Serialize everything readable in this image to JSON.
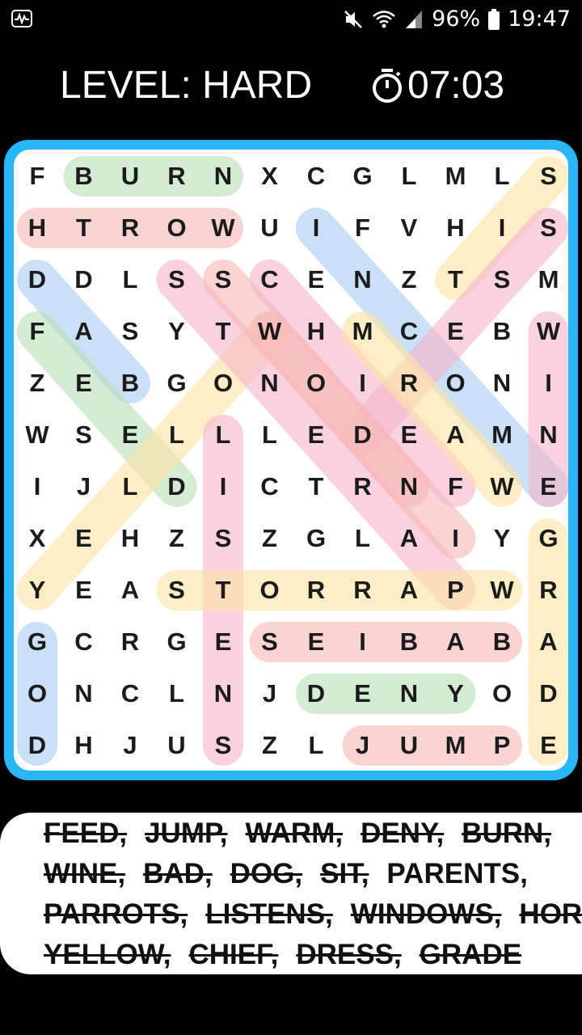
{
  "status": {
    "battery": "96%",
    "time": "19:47"
  },
  "header": {
    "level": "LEVEL: HARD",
    "timer": "07:03"
  },
  "grid": [
    [
      "F",
      "B",
      "U",
      "R",
      "N",
      "X",
      "C",
      "G",
      "L",
      "M",
      "L",
      "S"
    ],
    [
      "H",
      "T",
      "R",
      "O",
      "W",
      "U",
      "I",
      "F",
      "V",
      "H",
      "I",
      "S"
    ],
    [
      "D",
      "D",
      "L",
      "S",
      "S",
      "C",
      "E",
      "N",
      "Z",
      "T",
      "S",
      "M"
    ],
    [
      "F",
      "A",
      "S",
      "Y",
      "T",
      "W",
      "H",
      "M",
      "C",
      "E",
      "B",
      "W"
    ],
    [
      "Z",
      "E",
      "B",
      "G",
      "O",
      "N",
      "O",
      "I",
      "R",
      "O",
      "N",
      "I"
    ],
    [
      "W",
      "S",
      "E",
      "L",
      "L",
      "L",
      "E",
      "D",
      "E",
      "A",
      "M",
      "N"
    ],
    [
      "I",
      "J",
      "L",
      "D",
      "I",
      "C",
      "T",
      "R",
      "N",
      "F",
      "W",
      "E"
    ],
    [
      "X",
      "E",
      "H",
      "Z",
      "S",
      "Z",
      "G",
      "L",
      "A",
      "I",
      "Y",
      "G"
    ],
    [
      "Y",
      "E",
      "A",
      "S",
      "T",
      "O",
      "R",
      "R",
      "A",
      "P",
      "W",
      "R"
    ],
    [
      "G",
      "C",
      "R",
      "G",
      "E",
      "S",
      "E",
      "I",
      "B",
      "A",
      "B",
      "A"
    ],
    [
      "O",
      "N",
      "C",
      "L",
      "N",
      "J",
      "D",
      "E",
      "N",
      "Y",
      "O",
      "D"
    ],
    [
      "D",
      "H",
      "J",
      "U",
      "S",
      "Z",
      "L",
      "J",
      "U",
      "M",
      "P",
      "E"
    ]
  ],
  "highlights": [
    {
      "r1": 0,
      "c1": 1,
      "r2": 0,
      "c2": 4,
      "color": "#b9dfb9"
    },
    {
      "r1": 1,
      "c1": 0,
      "r2": 1,
      "c2": 4,
      "color": "#f7b8b8"
    },
    {
      "r1": 2,
      "c1": 0,
      "r2": 4,
      "c2": 2,
      "color": "#a9cdf2"
    },
    {
      "r1": 3,
      "c1": 0,
      "r2": 6,
      "c2": 3,
      "color": "#b9dfb9"
    },
    {
      "r1": 1,
      "c1": 6,
      "r2": 6,
      "c2": 11,
      "color": "#a9cdf2"
    },
    {
      "r1": 0,
      "c1": 11,
      "r2": 2,
      "c2": 9,
      "color": "#fbe3a4"
    },
    {
      "r1": 1,
      "c1": 11,
      "r2": 5,
      "c2": 7,
      "color": "#f5b5cc"
    },
    {
      "r1": 8,
      "c1": 0,
      "r2": 3,
      "c2": 5,
      "color": "#fbe3a4"
    },
    {
      "r1": 2,
      "c1": 3,
      "r2": 8,
      "c2": 9,
      "color": "#f5b5cc"
    },
    {
      "r1": 2,
      "c1": 4,
      "r2": 7,
      "c2": 9,
      "color": "#f7b8b8"
    },
    {
      "r1": 2,
      "c1": 5,
      "r2": 6,
      "c2": 9,
      "color": "#f5b5cc"
    },
    {
      "r1": 3,
      "c1": 5,
      "r2": 6,
      "c2": 8,
      "color": "#f7b8b8"
    },
    {
      "r1": 3,
      "c1": 7,
      "r2": 6,
      "c2": 10,
      "color": "#fbe3a4"
    },
    {
      "r1": 3,
      "c1": 11,
      "r2": 6,
      "c2": 11,
      "color": "#f5b5cc"
    },
    {
      "r1": 5,
      "c1": 4,
      "r2": 11,
      "c2": 4,
      "color": "#f5b5cc"
    },
    {
      "r1": 7,
      "c1": 11,
      "r2": 11,
      "c2": 11,
      "color": "#fbe3a4"
    },
    {
      "r1": 8,
      "c1": 3,
      "r2": 8,
      "c2": 10,
      "color": "#fbe3a4"
    },
    {
      "r1": 9,
      "c1": 5,
      "r2": 9,
      "c2": 10,
      "color": "#f7b8b8"
    },
    {
      "r1": 9,
      "c1": 0,
      "r2": 11,
      "c2": 0,
      "color": "#a9cdf2"
    },
    {
      "r1": 10,
      "c1": 6,
      "r2": 10,
      "c2": 9,
      "color": "#b9dfb9"
    },
    {
      "r1": 11,
      "c1": 7,
      "r2": 11,
      "c2": 10,
      "color": "#f7b8b8"
    }
  ],
  "words": [
    [
      "FEED,",
      "JUMP,",
      "WARM,",
      "DENY,",
      "BURN,"
    ],
    [
      "WINE,",
      "BAD,",
      "DOG,",
      "SIT,",
      "PARENTS,"
    ],
    [
      "PARROTS,",
      "LISTENS,",
      "WINDOWS,",
      "HORSES,"
    ],
    [
      "YELLOW,",
      "CHIEF,",
      "DRESS,",
      "GRADE"
    ]
  ],
  "found": [
    [
      true,
      true,
      true,
      true,
      true
    ],
    [
      true,
      true,
      true,
      true,
      false
    ],
    [
      true,
      true,
      true,
      true
    ],
    [
      true,
      true,
      true,
      true
    ]
  ]
}
